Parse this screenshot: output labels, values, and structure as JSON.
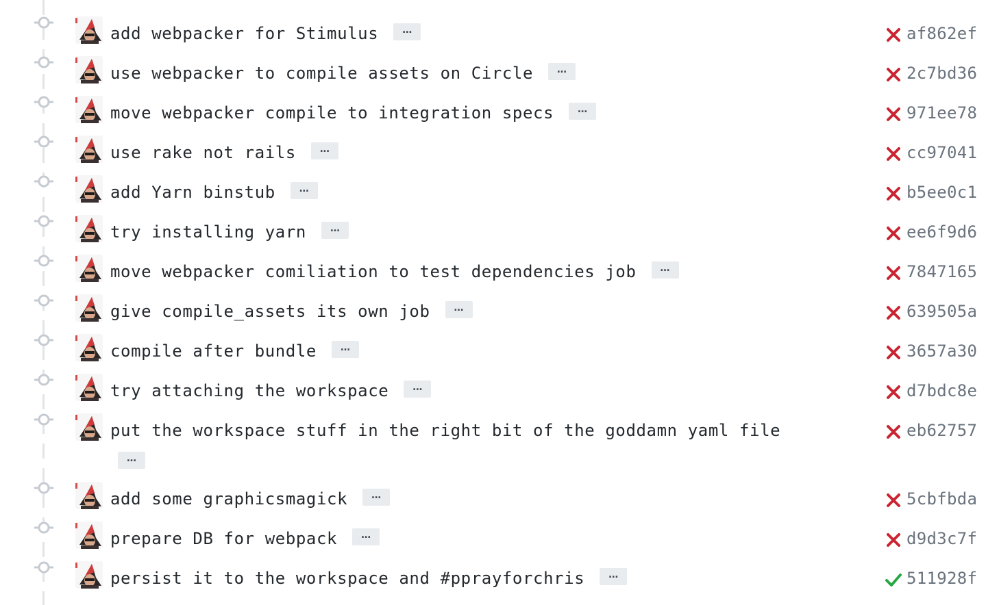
{
  "colors": {
    "failure": "#cb2431",
    "success": "#28a745",
    "sha": "#6a737d",
    "text": "#24292e",
    "timeline": "#e1e4e8",
    "ellipsis_bg": "#e9ecef"
  },
  "ellipsis_label": "…",
  "commits": [
    {
      "message": "add webpacker for Stimulus",
      "sha": "af862ef",
      "status": "failure"
    },
    {
      "message": "use webpacker to compile assets on Circle",
      "sha": "2c7bd36",
      "status": "failure"
    },
    {
      "message": "move webpacker compile to integration specs",
      "sha": "971ee78",
      "status": "failure"
    },
    {
      "message": "use rake not rails",
      "sha": "cc97041",
      "status": "failure"
    },
    {
      "message": "add Yarn binstub",
      "sha": "b5ee0c1",
      "status": "failure"
    },
    {
      "message": "try installing yarn",
      "sha": "ee6f9d6",
      "status": "failure"
    },
    {
      "message": "move webpacker comiliation to test dependencies job",
      "sha": "7847165",
      "status": "failure"
    },
    {
      "message": "give compile_assets its own job",
      "sha": "639505a",
      "status": "failure"
    },
    {
      "message": "compile after bundle",
      "sha": "3657a30",
      "status": "failure"
    },
    {
      "message": "try attaching the workspace",
      "sha": "d7bdc8e",
      "status": "failure"
    },
    {
      "message": "put the workspace stuff in the right bit of the goddamn yaml file",
      "sha": "eb62757",
      "status": "failure"
    },
    {
      "message": "add some graphicsmagick",
      "sha": "5cbfbda",
      "status": "failure"
    },
    {
      "message": "prepare DB for webpack",
      "sha": "d9d3c7f",
      "status": "failure"
    },
    {
      "message": "persist it to the workspace and #pprayforchris",
      "sha": "511928f",
      "status": "success"
    }
  ]
}
